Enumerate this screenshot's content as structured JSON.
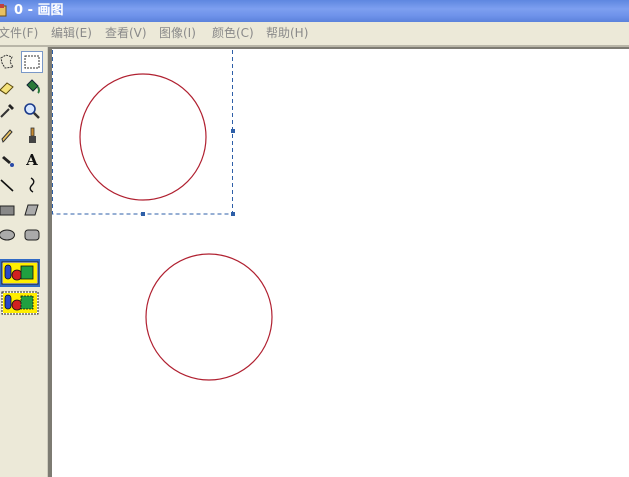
{
  "window": {
    "title": "0 - 画图",
    "title_icon": "paint-app-icon"
  },
  "menu": [
    {
      "label": "文件(F)"
    },
    {
      "label": "编辑(E)"
    },
    {
      "label": "查看(V)"
    },
    {
      "label": "图像(I)"
    },
    {
      "label": "颜色(C)"
    },
    {
      "label": "帮助(H)"
    }
  ],
  "toolbox": {
    "tools": [
      {
        "name": "free-form-select",
        "icon": "free-select-icon"
      },
      {
        "name": "select",
        "icon": "rect-select-icon",
        "selected": true
      },
      {
        "name": "eraser",
        "icon": "eraser-icon"
      },
      {
        "name": "fill",
        "icon": "fill-bucket-icon"
      },
      {
        "name": "pick-color",
        "icon": "eyedropper-icon"
      },
      {
        "name": "magnifier",
        "icon": "magnifier-icon"
      },
      {
        "name": "pencil",
        "icon": "pencil-icon"
      },
      {
        "name": "brush",
        "icon": "brush-icon"
      },
      {
        "name": "airbrush",
        "icon": "airbrush-icon"
      },
      {
        "name": "text",
        "icon": "text-icon",
        "glyph": "A"
      },
      {
        "name": "line",
        "icon": "line-icon"
      },
      {
        "name": "curve",
        "icon": "curve-icon"
      },
      {
        "name": "rectangle",
        "icon": "rectangle-icon"
      },
      {
        "name": "polygon",
        "icon": "polygon-icon"
      },
      {
        "name": "ellipse",
        "icon": "ellipse-icon"
      },
      {
        "name": "rounded-rectangle",
        "icon": "rounded-rect-icon"
      }
    ],
    "options": [
      {
        "name": "opaque-selection",
        "icon": "opaque-selection-icon",
        "selected": true
      },
      {
        "name": "transparent-selection",
        "icon": "transparent-selection-icon",
        "selected": false
      }
    ]
  },
  "canvas": {
    "background": "#ffffff",
    "shapes": [
      {
        "type": "circle",
        "stroke": "#b02030"
      },
      {
        "type": "circle",
        "stroke": "#b02030"
      }
    ],
    "selection": {
      "style": "dashed",
      "color": "#2e5fa8"
    }
  }
}
